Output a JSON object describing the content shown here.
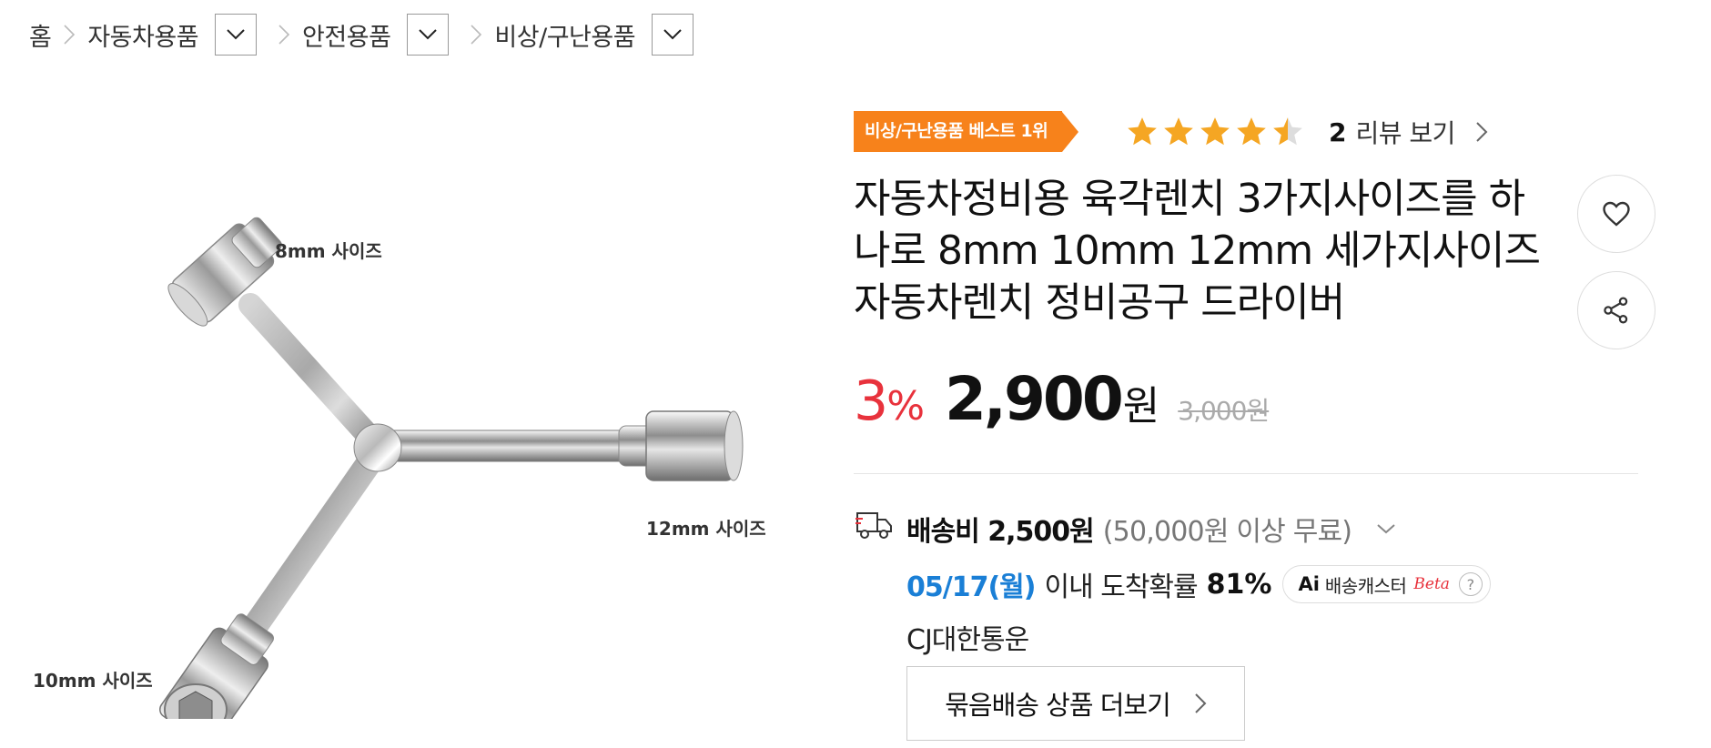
{
  "breadcrumb": {
    "home": "홈",
    "items": [
      {
        "label": "자동차용품"
      },
      {
        "label": "안전용품"
      },
      {
        "label": "비상/구난용품"
      }
    ]
  },
  "product": {
    "image": {
      "labels": {
        "top": "8mm 사이즈",
        "right": "12mm 사이즈",
        "bottom": "10mm 사이즈"
      }
    },
    "badge": "비상/구난용품 베스트 1위",
    "rating": {
      "stars": 4.5,
      "max": 5,
      "review_count": "2",
      "review_link": "리뷰 보기"
    },
    "title": "자동차정비용 육각렌치 3가지사이즈를 하나로 8mm 10mm 12mm 세가지사이즈 자동차렌치 정비공구 드라이버",
    "price": {
      "discount": "3",
      "discount_unit": "%",
      "sale": "2,900",
      "unit": "원",
      "original": "3,000원"
    },
    "shipping": {
      "label": "배송비 2,500원",
      "condition": "(50,000원 이상 무료)",
      "arrival_date": "05/17(월)",
      "arrival_text": "이내 도착확률",
      "arrival_pct": "81%",
      "caster_ai": "Ai",
      "caster_label": "배송캐스터",
      "caster_beta": "Beta",
      "caster_help": "?",
      "courier": "CJ대한통운",
      "bundle_button": "묶음배송 상품 더보기"
    }
  },
  "colors": {
    "accent_orange": "#f7821b",
    "star": "#f5a623",
    "discount_red": "#e8323c",
    "arrival_blue": "#1a7fd6"
  },
  "icons": {
    "wish": "heart-icon",
    "share": "share-icon",
    "shipping": "truck-icon"
  }
}
